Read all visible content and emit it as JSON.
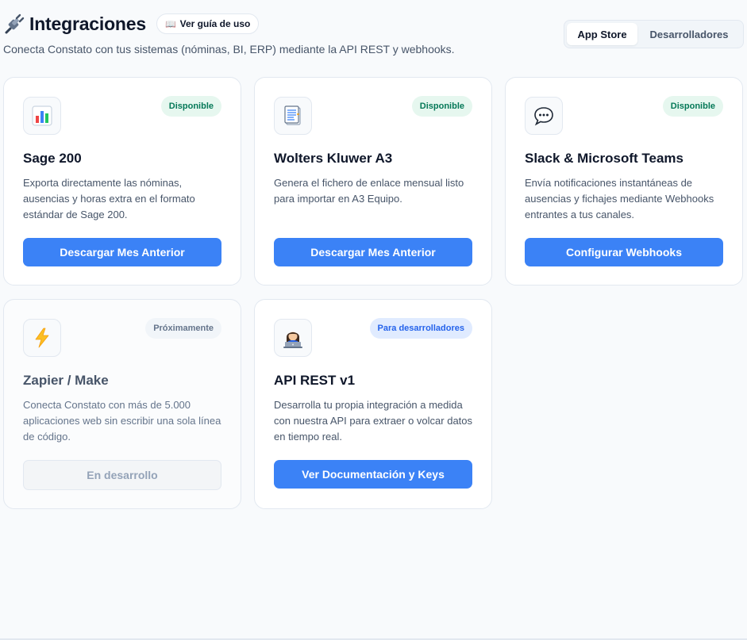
{
  "header": {
    "plug_icon": "electric-plug-icon",
    "title": "Integraciones",
    "guide_button": {
      "icon": "open-book-icon",
      "label": "Ver guía de uso"
    },
    "subtitle": "Conecta Constato con tus sistemas (nóminas, BI, ERP) mediante la API REST y webhooks."
  },
  "tabs": {
    "active": "App Store",
    "inactive": "Desarrolladores"
  },
  "cards": [
    {
      "icon": "bar-chart-icon",
      "badge": "Disponible",
      "title": "Sage 200",
      "description": "Exporta directamente las nóminas, ausencias y horas extra en el formato estándar de Sage 200.",
      "button": "Descargar Mes Anterior"
    },
    {
      "icon": "document-icon",
      "badge": "Disponible",
      "title": "Wolters Kluwer A3",
      "description": "Genera el fichero de enlace mensual listo para importar en A3 Equipo.",
      "button": "Descargar Mes Anterior"
    },
    {
      "icon": "speech-bubble-icon",
      "badge": "Disponible",
      "title": "Slack & Microsoft Teams",
      "description": "Envía notificaciones instantáneas de ausencias y fichajes mediante Webhooks entrantes a tus canales.",
      "button": "Configurar Webhooks"
    },
    {
      "icon": "lightning-icon",
      "badge": "Próximamente",
      "title": "Zapier / Make",
      "description": "Conecta Constato con más de 5.000 aplicaciones web sin escribir una sola línea de código.",
      "button": "En desarrollo"
    },
    {
      "icon": "developer-laptop-icon",
      "badge": "Para desarrolladores",
      "title": "API REST v1",
      "description": "Desarrolla tu propia integración a medida con nuestra API para extraer o volcar datos en tiempo real.",
      "button": "Ver Documentación y Keys"
    }
  ]
}
